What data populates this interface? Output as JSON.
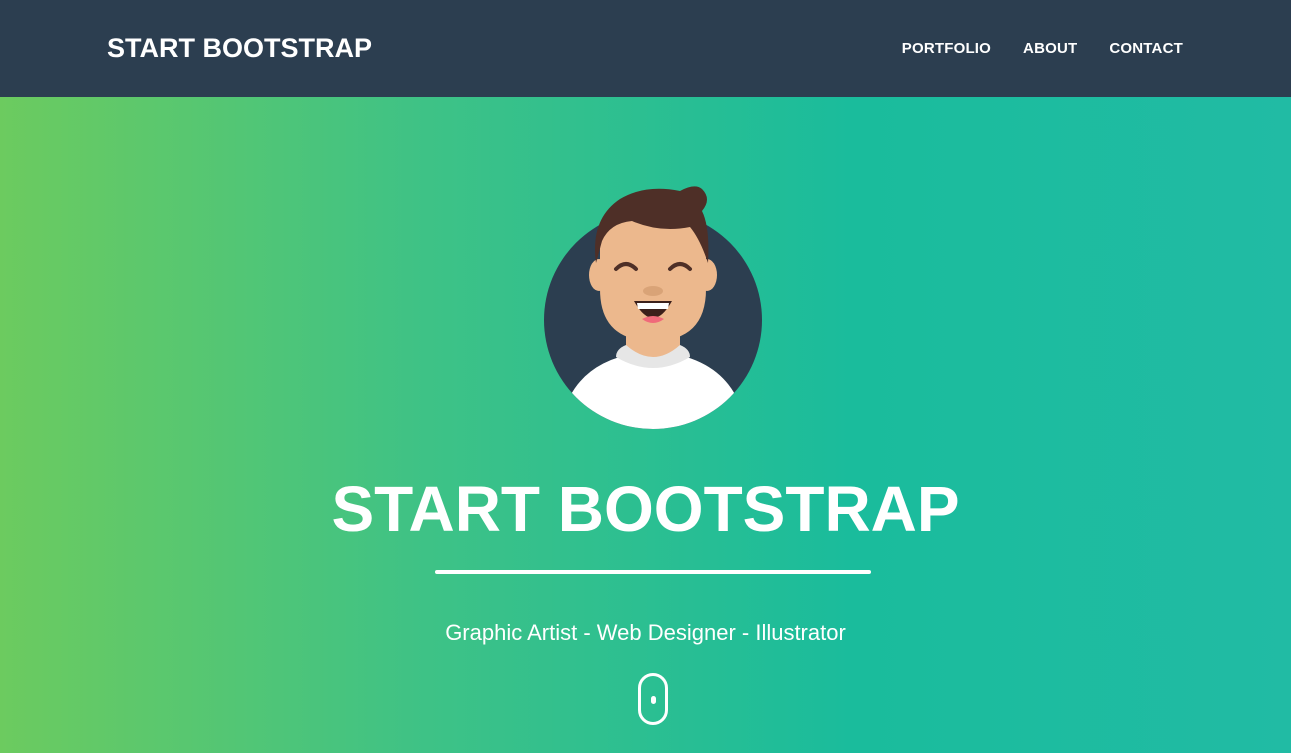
{
  "navbar": {
    "brand": "START BOOTSTRAP",
    "links": [
      {
        "label": "PORTFOLIO"
      },
      {
        "label": "ABOUT"
      },
      {
        "label": "CONTACT"
      }
    ],
    "background": "#2c3e50"
  },
  "hero": {
    "title": "START BOOTSTRAP",
    "subtitle": "Graphic Artist - Web Designer - Illustrator",
    "avatar_icon": "avatar-illustration",
    "scroll_icon": "mouse-scroll-icon",
    "gradient": [
      "#6ccb5f",
      "#1abc9c",
      "#21bba4"
    ]
  }
}
